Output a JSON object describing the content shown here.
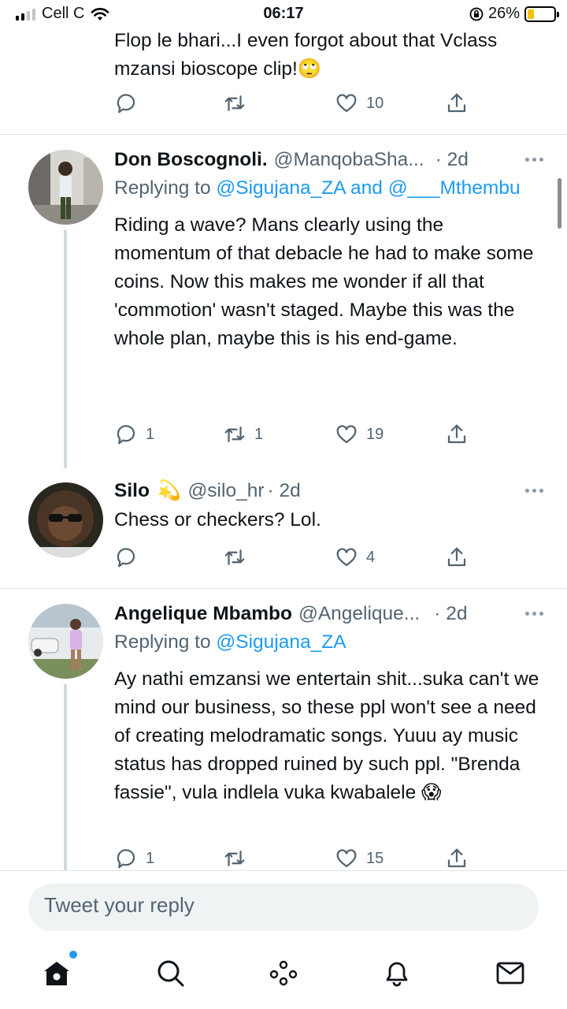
{
  "status_bar": {
    "carrier": "Cell C",
    "time": "06:17",
    "battery": "26%",
    "battery_level": 0.26
  },
  "top_fragment": {
    "text": "Flop le bhari...I even forgot about that Vclass mzansi bioscope clip!🙄",
    "likes": "10"
  },
  "tweets": [
    {
      "name": "Don Boscognoli.",
      "handle": "@ManqobaSha...",
      "time": "· 2d",
      "replying_prefix": "Replying to ",
      "replying_to": "@Sigujana_ZA and @___Mthembu",
      "text": "Riding a wave? Mans clearly using the momentum of that debacle he had to make some coins. Now this makes me wonder if all that 'commotion' wasn't staged. Maybe this was the whole plan, maybe this is his end-game.",
      "replies": "1",
      "retweets": "1",
      "likes": "19"
    },
    {
      "name": "Silo",
      "emoji": "💫",
      "handle": "@silo_hr",
      "time": "· 2d",
      "text": "Chess or checkers? Lol.",
      "replies": "",
      "retweets": "",
      "likes": "4"
    },
    {
      "name": "Angelique Mbambo",
      "handle": "@Angelique...",
      "time": "· 2d",
      "replying_prefix": "Replying to ",
      "replying_to": "@Sigujana_ZA",
      "text": "Ay nathi emzansi we entertain shit...suka can't we mind our business, so these ppl won't see a need of creating melodramatic songs. Yuuu ay music status has dropped ruined by such ppl. \"Brenda fassie\", vula indlela vuka kwabalele 😱",
      "replies": "1",
      "retweets": "",
      "likes": "15"
    }
  ],
  "reply_bar": {
    "placeholder": "Tweet your reply"
  },
  "colors": {
    "accent": "#1d9bf0",
    "secondary_text": "#536471",
    "divider": "#e1e6ea"
  },
  "tabs": [
    "home-icon",
    "search-icon",
    "spaces-icon",
    "notifications-icon",
    "messages-icon"
  ]
}
